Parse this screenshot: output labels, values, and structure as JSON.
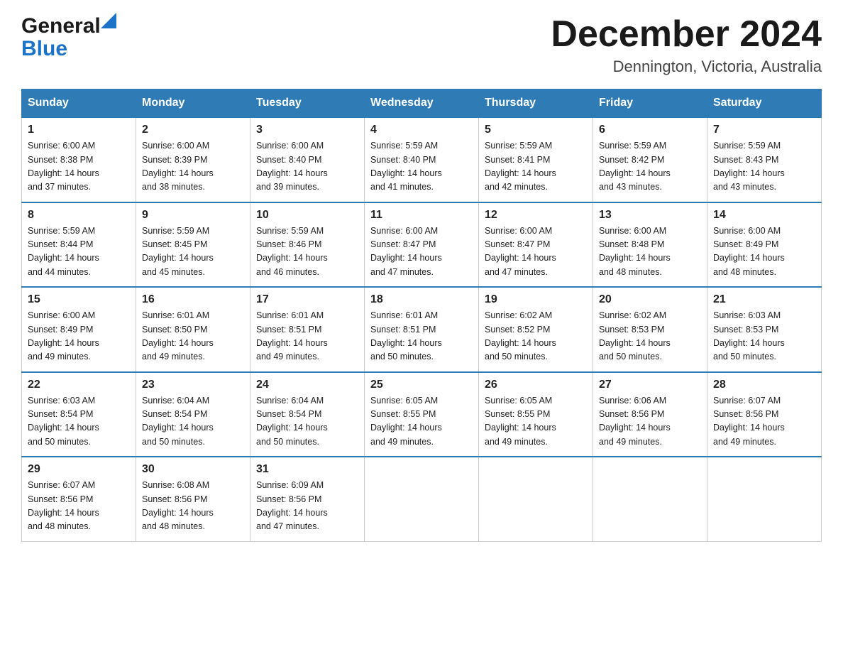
{
  "header": {
    "logo_general": "General",
    "logo_blue": "Blue",
    "month_title": "December 2024",
    "location": "Dennington, Victoria, Australia"
  },
  "days_of_week": [
    "Sunday",
    "Monday",
    "Tuesday",
    "Wednesday",
    "Thursday",
    "Friday",
    "Saturday"
  ],
  "weeks": [
    [
      {
        "day": "1",
        "sunrise": "6:00 AM",
        "sunset": "8:38 PM",
        "daylight": "14 hours and 37 minutes."
      },
      {
        "day": "2",
        "sunrise": "6:00 AM",
        "sunset": "8:39 PM",
        "daylight": "14 hours and 38 minutes."
      },
      {
        "day": "3",
        "sunrise": "6:00 AM",
        "sunset": "8:40 PM",
        "daylight": "14 hours and 39 minutes."
      },
      {
        "day": "4",
        "sunrise": "5:59 AM",
        "sunset": "8:40 PM",
        "daylight": "14 hours and 41 minutes."
      },
      {
        "day": "5",
        "sunrise": "5:59 AM",
        "sunset": "8:41 PM",
        "daylight": "14 hours and 42 minutes."
      },
      {
        "day": "6",
        "sunrise": "5:59 AM",
        "sunset": "8:42 PM",
        "daylight": "14 hours and 43 minutes."
      },
      {
        "day": "7",
        "sunrise": "5:59 AM",
        "sunset": "8:43 PM",
        "daylight": "14 hours and 43 minutes."
      }
    ],
    [
      {
        "day": "8",
        "sunrise": "5:59 AM",
        "sunset": "8:44 PM",
        "daylight": "14 hours and 44 minutes."
      },
      {
        "day": "9",
        "sunrise": "5:59 AM",
        "sunset": "8:45 PM",
        "daylight": "14 hours and 45 minutes."
      },
      {
        "day": "10",
        "sunrise": "5:59 AM",
        "sunset": "8:46 PM",
        "daylight": "14 hours and 46 minutes."
      },
      {
        "day": "11",
        "sunrise": "6:00 AM",
        "sunset": "8:47 PM",
        "daylight": "14 hours and 47 minutes."
      },
      {
        "day": "12",
        "sunrise": "6:00 AM",
        "sunset": "8:47 PM",
        "daylight": "14 hours and 47 minutes."
      },
      {
        "day": "13",
        "sunrise": "6:00 AM",
        "sunset": "8:48 PM",
        "daylight": "14 hours and 48 minutes."
      },
      {
        "day": "14",
        "sunrise": "6:00 AM",
        "sunset": "8:49 PM",
        "daylight": "14 hours and 48 minutes."
      }
    ],
    [
      {
        "day": "15",
        "sunrise": "6:00 AM",
        "sunset": "8:49 PM",
        "daylight": "14 hours and 49 minutes."
      },
      {
        "day": "16",
        "sunrise": "6:01 AM",
        "sunset": "8:50 PM",
        "daylight": "14 hours and 49 minutes."
      },
      {
        "day": "17",
        "sunrise": "6:01 AM",
        "sunset": "8:51 PM",
        "daylight": "14 hours and 49 minutes."
      },
      {
        "day": "18",
        "sunrise": "6:01 AM",
        "sunset": "8:51 PM",
        "daylight": "14 hours and 50 minutes."
      },
      {
        "day": "19",
        "sunrise": "6:02 AM",
        "sunset": "8:52 PM",
        "daylight": "14 hours and 50 minutes."
      },
      {
        "day": "20",
        "sunrise": "6:02 AM",
        "sunset": "8:53 PM",
        "daylight": "14 hours and 50 minutes."
      },
      {
        "day": "21",
        "sunrise": "6:03 AM",
        "sunset": "8:53 PM",
        "daylight": "14 hours and 50 minutes."
      }
    ],
    [
      {
        "day": "22",
        "sunrise": "6:03 AM",
        "sunset": "8:54 PM",
        "daylight": "14 hours and 50 minutes."
      },
      {
        "day": "23",
        "sunrise": "6:04 AM",
        "sunset": "8:54 PM",
        "daylight": "14 hours and 50 minutes."
      },
      {
        "day": "24",
        "sunrise": "6:04 AM",
        "sunset": "8:54 PM",
        "daylight": "14 hours and 50 minutes."
      },
      {
        "day": "25",
        "sunrise": "6:05 AM",
        "sunset": "8:55 PM",
        "daylight": "14 hours and 49 minutes."
      },
      {
        "day": "26",
        "sunrise": "6:05 AM",
        "sunset": "8:55 PM",
        "daylight": "14 hours and 49 minutes."
      },
      {
        "day": "27",
        "sunrise": "6:06 AM",
        "sunset": "8:56 PM",
        "daylight": "14 hours and 49 minutes."
      },
      {
        "day": "28",
        "sunrise": "6:07 AM",
        "sunset": "8:56 PM",
        "daylight": "14 hours and 49 minutes."
      }
    ],
    [
      {
        "day": "29",
        "sunrise": "6:07 AM",
        "sunset": "8:56 PM",
        "daylight": "14 hours and 48 minutes."
      },
      {
        "day": "30",
        "sunrise": "6:08 AM",
        "sunset": "8:56 PM",
        "daylight": "14 hours and 48 minutes."
      },
      {
        "day": "31",
        "sunrise": "6:09 AM",
        "sunset": "8:56 PM",
        "daylight": "14 hours and 47 minutes."
      },
      null,
      null,
      null,
      null
    ]
  ],
  "labels": {
    "sunrise": "Sunrise:",
    "sunset": "Sunset:",
    "daylight": "Daylight:"
  }
}
